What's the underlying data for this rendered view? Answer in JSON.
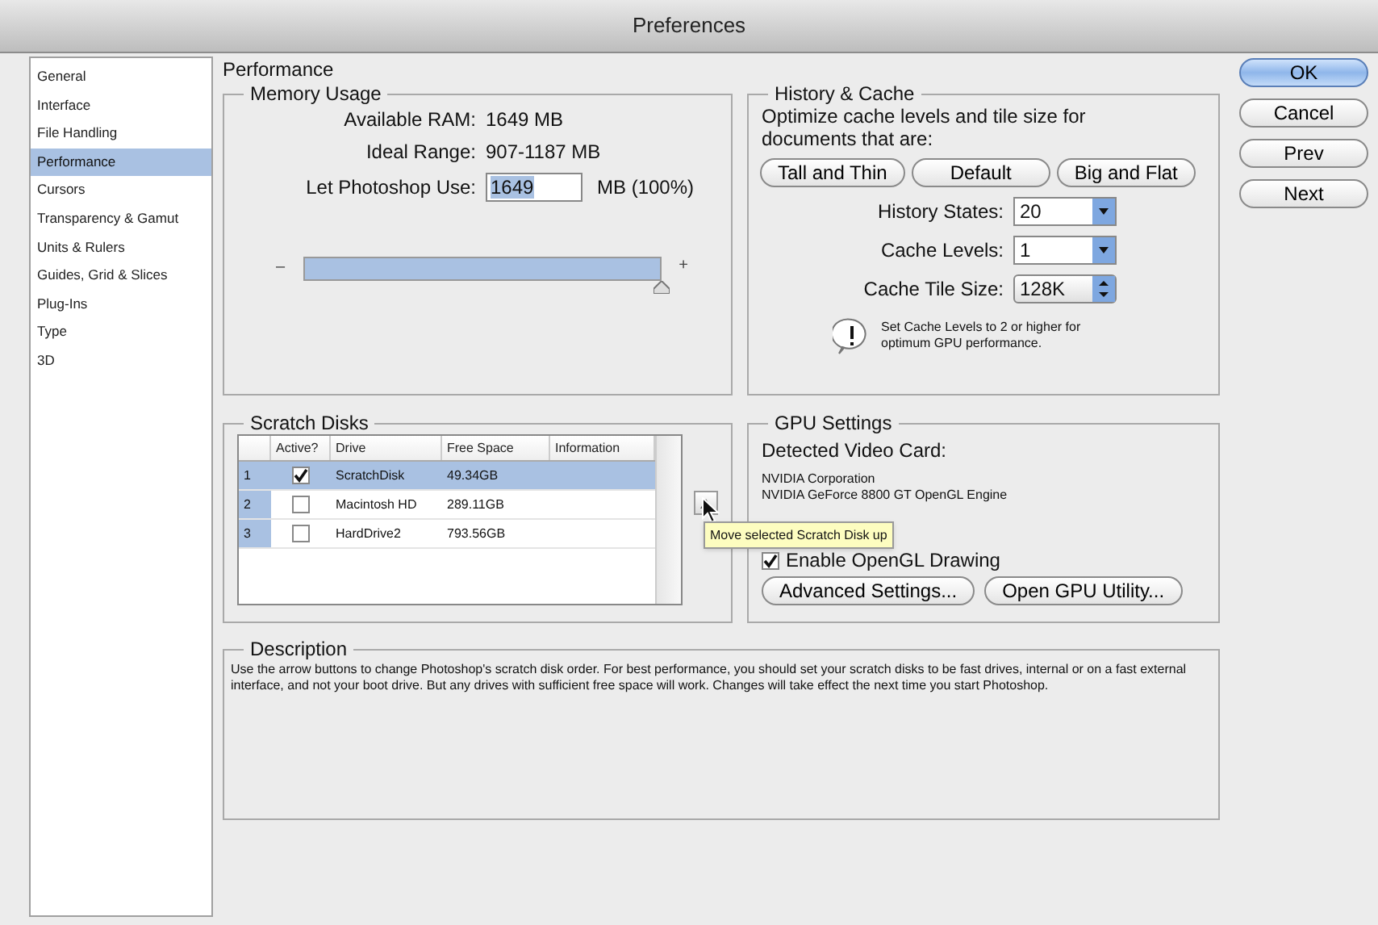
{
  "window": {
    "title": "Preferences"
  },
  "sidebar": {
    "items": [
      {
        "label": "General",
        "selected": false
      },
      {
        "label": "Interface",
        "selected": false
      },
      {
        "label": "File Handling",
        "selected": false
      },
      {
        "label": "Performance",
        "selected": true
      },
      {
        "label": "Cursors",
        "selected": false
      },
      {
        "label": "Transparency & Gamut",
        "selected": false
      },
      {
        "label": "Units & Rulers",
        "selected": false
      },
      {
        "label": "Guides, Grid & Slices",
        "selected": false
      },
      {
        "label": "Plug-Ins",
        "selected": false
      },
      {
        "label": "Type",
        "selected": false
      },
      {
        "label": "3D",
        "selected": false
      }
    ]
  },
  "page_title": "Performance",
  "memory_usage": {
    "title": "Memory Usage",
    "available_label": "Available RAM:",
    "available_value": "1649 MB",
    "ideal_label": "Ideal Range:",
    "ideal_value": "907-1187 MB",
    "use_label": "Let Photoshop Use:",
    "use_value": "1649",
    "use_unit": "MB (100%)",
    "slider": {
      "min_label": "–",
      "max_label": "+",
      "level": 1
    }
  },
  "history_cache": {
    "title": "History & Cache",
    "intro": "Optimize cache levels and tile size for documents that are:",
    "presets": [
      "Tall and Thin",
      "Default",
      "Big and Flat"
    ],
    "fields": [
      {
        "label": "History States:",
        "value": "20",
        "kind": "combo"
      },
      {
        "label": "Cache Levels:",
        "value": "1",
        "kind": "combo"
      },
      {
        "label": "Cache Tile Size:",
        "value": "128K",
        "kind": "popup"
      }
    ],
    "notice": "Set Cache Levels to 2 or higher for optimum GPU performance."
  },
  "scratch_disks": {
    "title": "Scratch Disks",
    "columns": [
      "Active?",
      "Drive",
      "Free Space",
      "Information"
    ],
    "rows": [
      {
        "index": "1",
        "active": true,
        "drive": "ScratchDisk",
        "free_space": "49.34GB",
        "selected": true
      },
      {
        "index": "2",
        "active": false,
        "drive": "Macintosh HD",
        "free_space": "289.11GB",
        "selected": false
      },
      {
        "index": "3",
        "active": false,
        "drive": "HardDrive2",
        "free_space": "793.56GB",
        "selected": false
      }
    ],
    "tooltip": "Move selected Scratch Disk up"
  },
  "gpu_settings": {
    "title": "GPU Settings",
    "detected_label": "Detected Video Card:",
    "card_lines": [
      "NVIDIA Corporation",
      "NVIDIA GeForce 8800 GT OpenGL Engine"
    ],
    "opengl": {
      "label": "Enable OpenGL Drawing",
      "checked": true
    },
    "buttons": [
      "Advanced Settings...",
      "Open GPU Utility..."
    ]
  },
  "description": {
    "title": "Description",
    "text": "Use the arrow buttons to change Photoshop's scratch disk order. For best performance, you should set your scratch disks to be fast drives, internal or on a fast external interface, and not your boot drive. But any drives with sufficient free space will work. Changes will take effect the next time you start Photoshop."
  },
  "buttons": [
    {
      "label": "OK",
      "default": true
    },
    {
      "label": "Cancel",
      "default": false
    },
    {
      "label": "Prev",
      "default": false
    },
    {
      "label": "Next",
      "default": false
    }
  ]
}
